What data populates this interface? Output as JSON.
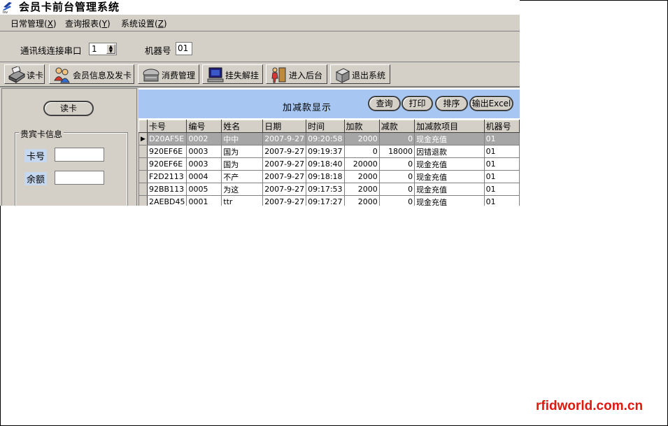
{
  "app": {
    "title": "会员卡前台管理系统"
  },
  "menu": [
    {
      "label": "日常管理(",
      "key": "X",
      "end": ")"
    },
    {
      "label": "查询报表(",
      "key": "Y",
      "end": ")"
    },
    {
      "label": "系统设置(",
      "key": "Z",
      "end": ")"
    }
  ],
  "settings": {
    "port_label": "通讯线连接串口",
    "port_value": "1",
    "machine_label": "机器号",
    "machine_value": "01"
  },
  "toolbar": {
    "read_card": "读卡",
    "member_info": "会员信息及发卡",
    "consumption": "消费管理",
    "report_loss": "挂失解挂",
    "backend": "进入后台",
    "exit": "退出系统"
  },
  "left": {
    "read_button": "读卡",
    "group_title": "贵宾卡信息",
    "card_no_label": "卡号",
    "balance_label": "余额",
    "card_no_value": "",
    "balance_value": ""
  },
  "right": {
    "band_title": "加减款显示",
    "query": "查询",
    "print": "打印",
    "sort": "排序",
    "export": "输出Excel",
    "columns": [
      "卡号",
      "编号",
      "姓名",
      "日期",
      "时间",
      "加款",
      "减款",
      "加减款项目",
      "机器号"
    ],
    "rows": [
      [
        "D20AF5E",
        "0002",
        "中中",
        "2007-9-27",
        "09:20:58",
        "2000",
        "0",
        "现金充值",
        "01"
      ],
      [
        "920EF6E",
        "0003",
        "国为",
        "2007-9-27",
        "09:19:37",
        "0",
        "18000",
        "因错退款",
        "01"
      ],
      [
        "920EF6E",
        "0003",
        "国为",
        "2007-9-27",
        "09:18:40",
        "20000",
        "0",
        "现金充值",
        "01"
      ],
      [
        "F2D2113",
        "0004",
        "不产",
        "2007-9-27",
        "09:18:18",
        "2000",
        "0",
        "现金充值",
        "01"
      ],
      [
        "92BB113",
        "0005",
        "为这",
        "2007-9-27",
        "09:17:53",
        "2000",
        "0",
        "现金充值",
        "01"
      ],
      [
        "2AEBD45",
        "0001",
        "ttr",
        "2007-9-27",
        "09:17:27",
        "2000",
        "0",
        "现金充值",
        "01"
      ]
    ]
  },
  "watermark": "rfidworld.com.cn",
  "colors": {
    "band": "#a7c7f2",
    "window": "#d4d0c8",
    "watermark": "#e0190f"
  }
}
